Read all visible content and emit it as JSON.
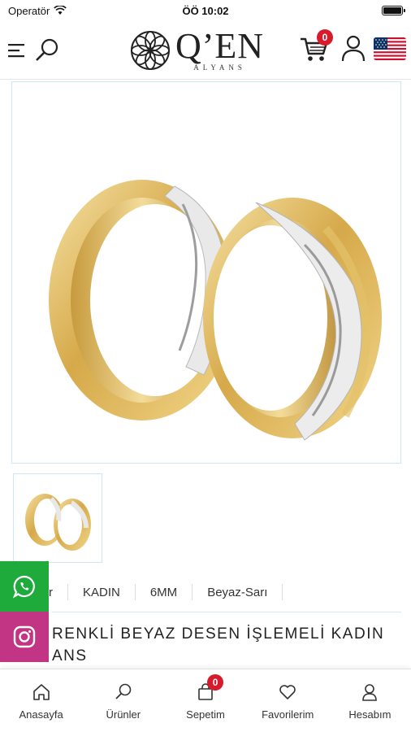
{
  "status_bar": {
    "carrier": "Operatör",
    "time": "ÖÖ 10:02"
  },
  "header": {
    "logo_name": "Q’EN",
    "logo_sub": "ALYANS",
    "cart_count": "0"
  },
  "product": {
    "tags": [
      "r",
      "KADIN",
      "6MM",
      "Beyaz-Sarı"
    ],
    "title": "RENKLİ BEYAZ DESEN İŞLEMELİ KADIN ANS"
  },
  "tabbar": {
    "items": [
      {
        "label": "Anasayfa",
        "icon": "home-icon"
      },
      {
        "label": "Ürünler",
        "icon": "search-icon"
      },
      {
        "label": "Sepetim",
        "icon": "bag-icon",
        "badge": "0"
      },
      {
        "label": "Favorilerim",
        "icon": "heart-icon"
      },
      {
        "label": "Hesabım",
        "icon": "user-icon"
      }
    ]
  },
  "colors": {
    "accent": "#d81b2c",
    "whatsapp": "#1faa3c",
    "instagram": "#c13584",
    "frame": "#cfe6f5"
  }
}
